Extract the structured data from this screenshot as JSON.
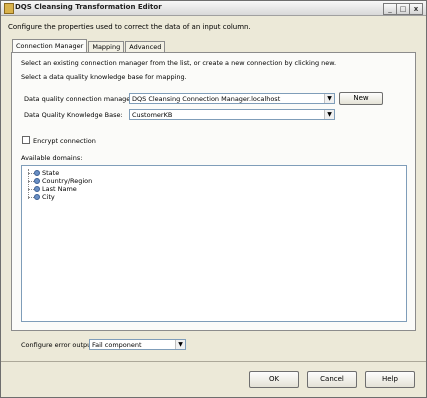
{
  "window": {
    "title": "DQS Cleansing Transformation Editor",
    "subtitle": "Configure the properties used to correct the data of an input column."
  },
  "tabs": [
    {
      "label": "Connection Manager",
      "active": true
    },
    {
      "label": "Mapping",
      "active": false
    },
    {
      "label": "Advanced",
      "active": false
    }
  ],
  "connection": {
    "intro1": "Select an existing connection manager from the list, or create a new connection by clicking new.",
    "intro2": "Select a data quality knowledge base for mapping.",
    "manager_label": "Data quality connection manager:",
    "manager_value": "DQS Cleansing Connection Manager.localhost",
    "new_label": "New",
    "kb_label": "Data Quality Knowledge Base:",
    "kb_value": "CustomerKB",
    "encrypt_label": "Encrypt connection",
    "encrypt_checked": false,
    "domains_label": "Available domains:",
    "domains": [
      "State",
      "Country/Region",
      "Last Name",
      "City"
    ]
  },
  "error_output": {
    "label": "Configure error output:",
    "value": "Fail component"
  },
  "buttons": {
    "ok": "OK",
    "cancel": "Cancel",
    "help": "Help"
  },
  "window_controls": {
    "minimize": "_",
    "maximize": "□",
    "close": "x"
  }
}
